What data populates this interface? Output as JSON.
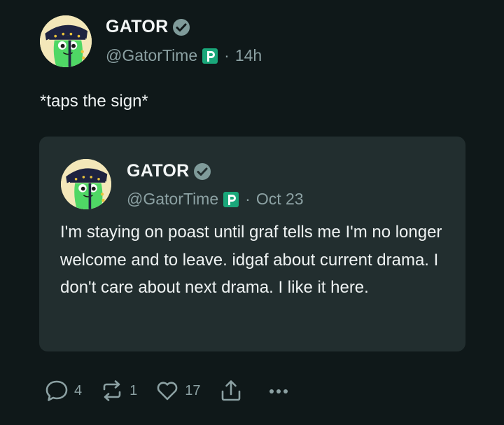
{
  "post": {
    "author": {
      "display_name": "GATOR",
      "handle": "@GatorTime",
      "separator": "·",
      "time": "14h"
    },
    "text": "*taps the sign*"
  },
  "quote": {
    "author": {
      "display_name": "GATOR",
      "handle": "@GatorTime",
      "separator": "·",
      "time": "Oct 23"
    },
    "text": "I'm staying on poast until graf tells me I'm no longer welcome and to leave. idgaf about current drama. I don't care about next drama. I like it here."
  },
  "actions": {
    "replies": "4",
    "reposts": "1",
    "likes": "17"
  },
  "icons": {
    "avatar": "gator-avatar",
    "verified": "verified-check-icon",
    "instance": "poast-p-icon",
    "reply": "reply-icon",
    "repost": "repost-icon",
    "like": "heart-icon",
    "share": "share-icon",
    "more": "more-icon"
  },
  "colors": {
    "background": "#0f1819",
    "card": "#222e2f",
    "muted": "#8ca1a3",
    "verified": "#7f9b9a",
    "poast_green": "#1aa77a"
  }
}
